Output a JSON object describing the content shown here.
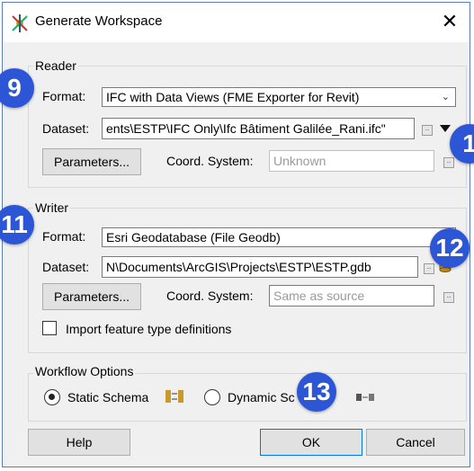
{
  "window": {
    "title": "Generate Workspace",
    "close_label": "✕"
  },
  "reader": {
    "group_label": "Reader",
    "format_label": "Format:",
    "format_value": "IFC with Data Views (FME Exporter for Revit)",
    "dataset_label": "Dataset:",
    "dataset_value": "ents\\ESTP\\IFC Only\\Ifc Bâtiment Galilée_Rani.ifc\"",
    "parameters_label": "Parameters...",
    "coord_label": "Coord. System:",
    "coord_value": "Unknown"
  },
  "writer": {
    "group_label": "Writer",
    "format_label": "Format:",
    "format_value": "Esri Geodatabase (File Geodb)",
    "dataset_label": "Dataset:",
    "dataset_value": "N\\Documents\\ArcGIS\\Projects\\ESTP\\ESTP.gdb",
    "parameters_label": "Parameters...",
    "coord_label": "Coord. System:",
    "coord_placeholder": "Same as source",
    "import_label": "Import feature type definitions",
    "import_checked": false
  },
  "workflow": {
    "group_label": "Workflow Options",
    "static_label": "Static Schema",
    "dynamic_label": "Dynamic Sc",
    "selected": "static"
  },
  "buttons": {
    "help": "Help",
    "ok": "OK",
    "cancel": "Cancel"
  },
  "badges": {
    "b9": "9",
    "b1": "1",
    "b11": "11",
    "b12": "12",
    "b13": "13"
  },
  "mini_button_label": "..",
  "colors": {
    "badge": "#2d56d6",
    "dialog_border": "#5a7fb8"
  }
}
